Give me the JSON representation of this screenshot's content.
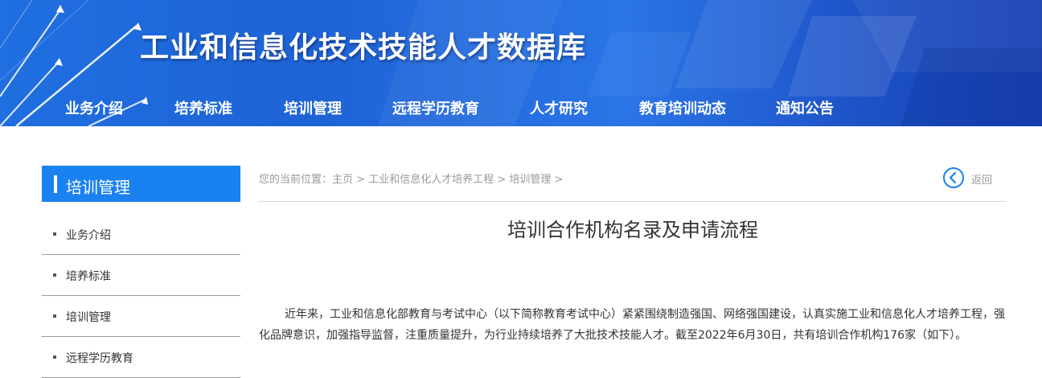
{
  "banner": {
    "title": "工业和信息化技术技能人才数据库",
    "colors": {
      "primary": "#1e63d6",
      "accent": "#1a82f0"
    }
  },
  "nav": {
    "items": [
      {
        "label": "业务介绍"
      },
      {
        "label": "培养标准"
      },
      {
        "label": "培训管理"
      },
      {
        "label": "远程学历教育"
      },
      {
        "label": "人才研究"
      },
      {
        "label": "教育培训动态"
      },
      {
        "label": "通知公告"
      }
    ]
  },
  "sidebar": {
    "heading": "培训管理",
    "items": [
      {
        "label": "业务介绍"
      },
      {
        "label": "培养标准"
      },
      {
        "label": "培训管理"
      },
      {
        "label": "远程学历教育"
      }
    ]
  },
  "breadcrumb": {
    "prefix": "您的当前位置：",
    "home": "主页",
    "sep": " > ",
    "level1": "工业和信息化人才培养工程",
    "level2": "培训管理",
    "trail_end": " >"
  },
  "back": {
    "label": "返回",
    "icon": "chevron-left-circle-icon"
  },
  "article": {
    "title": "培训合作机构名录及申请流程",
    "paragraph": "近年来，工业和信息化部教育与考试中心（以下简称教育考试中心）紧紧围绕制造强国、网络强国建设，认真实施工业和信息化人才培养工程，强化品牌意识，加强指导监督，注重质量提升，为行业持续培养了大批技术技能人才。截至2022年6月30日，共有培训合作机构176家（如下）。"
  }
}
